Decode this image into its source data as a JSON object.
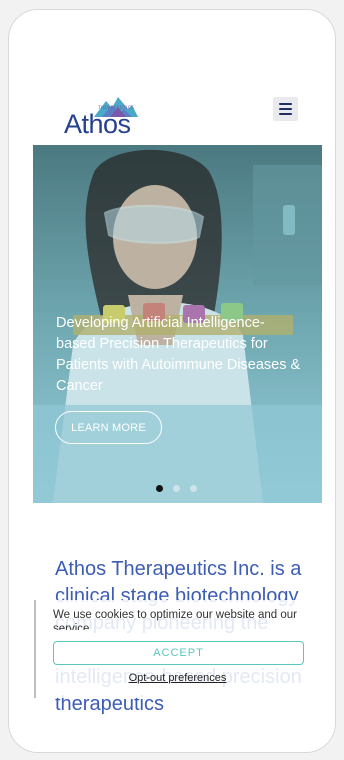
{
  "header": {
    "logo_text": "Athos",
    "logo_subtext": "THERAPEUTICS",
    "menu_icon": "hamburger-menu-icon"
  },
  "hero": {
    "title": "Developing Artificial Intelligence-based Precision Therapeutics for Patients with Autoimmune Diseases & Cancer",
    "button_label": "LEARN MORE",
    "carousel": {
      "slides": 3,
      "active_index": 0
    }
  },
  "intro": {
    "text": "Athos Therapeutics Inc. is a clinical stage biotechnology company pioneering the development of artificial intelligence-based precision therapeutics"
  },
  "cookie_banner": {
    "message": "We use cookies to optimize our website and our service.",
    "accept_label": "ACCEPT",
    "optout_label": "Opt-out preferences"
  },
  "colors": {
    "brand_blue": "#25418e",
    "intro_blue": "#3d5db4",
    "accent_teal": "#5cc7c0"
  }
}
